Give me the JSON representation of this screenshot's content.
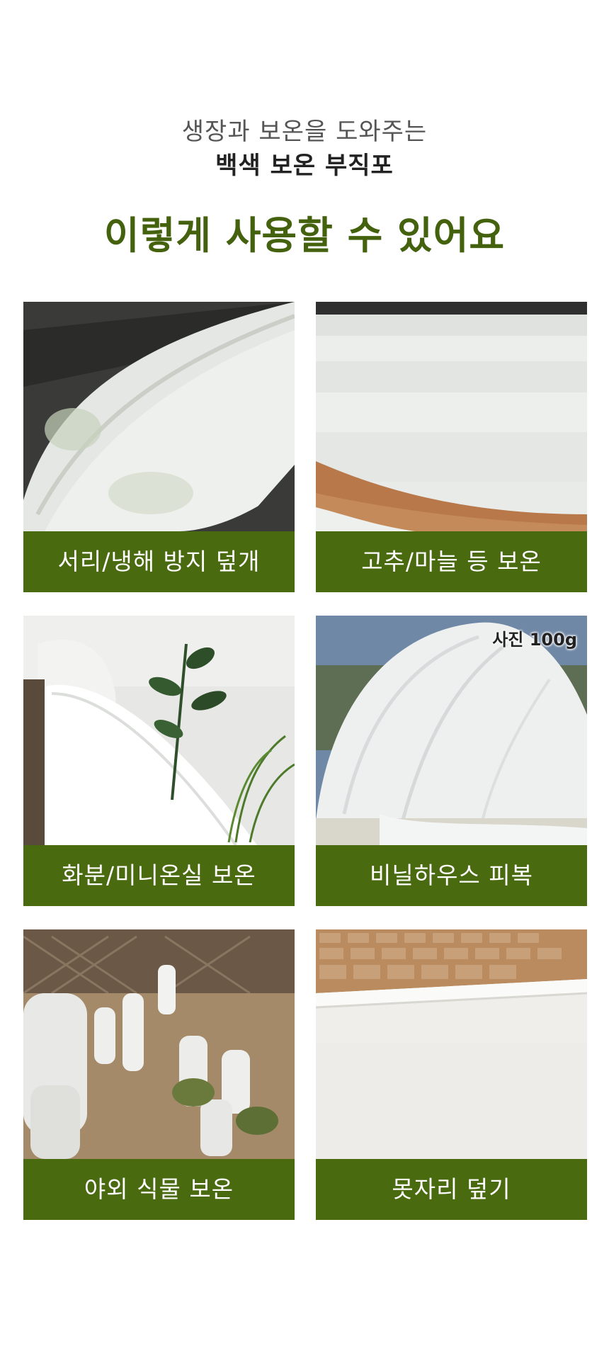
{
  "header": {
    "subtitle_line1": "생장과 보온을 도와주는",
    "subtitle_line2": "백색 보온 부직포",
    "title": "이렇게 사용할 수 있어요"
  },
  "cards": [
    {
      "caption": "서리/냉해 방지 덮개",
      "photo": "frost-cover-rows-photo"
    },
    {
      "caption": "고추/마늘 등 보온",
      "photo": "pepper-garlic-field-photo"
    },
    {
      "caption": "화분/미니온실 보온",
      "photo": "potted-plant-wrap-photo"
    },
    {
      "caption": "비닐하우스 피복",
      "photo": "greenhouse-cover-photo",
      "badge": "사진 100g"
    },
    {
      "caption": "야외 식물 보온",
      "photo": "outdoor-plants-wrap-photo"
    },
    {
      "caption": "못자리 덮기",
      "photo": "seedbed-cover-photo"
    }
  ]
}
